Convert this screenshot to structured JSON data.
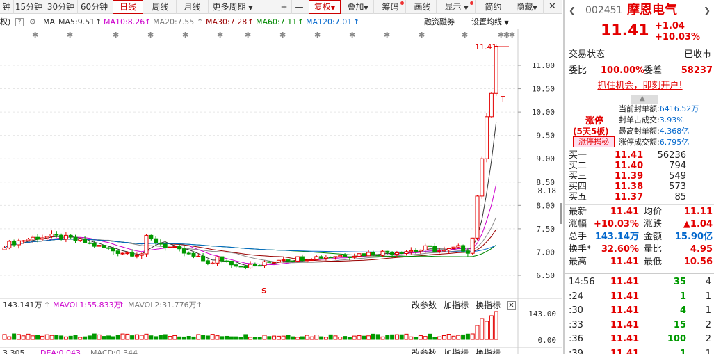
{
  "toolbar": {
    "periods": [
      "钟",
      "15分钟",
      "30分钟",
      "60分钟",
      "日线",
      "周线",
      "月线",
      "更多周期"
    ],
    "active_period": "日线",
    "plus": "+",
    "minus": "—",
    "fq_label": "复权",
    "overlay_label": "叠加",
    "chips_label": "筹码",
    "draw_label": "画线",
    "display_label": "显示",
    "simple_label": "简约",
    "hide_label": "隐藏"
  },
  "ma_bar": {
    "prefix": "权)",
    "ma_label": "MA",
    "ma5": "MA5:9.51",
    "ma10": "MA10:8.26",
    "ma20": "MA20:7.55",
    "ma30": "MA30:7.28",
    "ma60": "MA60:7.11",
    "ma120": "MA120:7.01",
    "margin_label": "融资融券",
    "settings_label": "设置均线"
  },
  "price_axis": [
    "11.00",
    "10.50",
    "10.00",
    "9.50",
    "9.00",
    "8.50",
    "8.00",
    "7.50",
    "7.00",
    "6.50"
  ],
  "crosshair_value": "8.18",
  "last_price_marker": "11.41",
  "marker_t": "T",
  "marker_s": "S",
  "volume_bar": {
    "vol": "143.141万",
    "mavol1": "MAVOL1:55.833万",
    "mavol2": "MAVOL2:31.776万",
    "edit_params": "改参数",
    "add_indicator": "加指标",
    "switch_indicator": "换指标",
    "axis_top": "143.00",
    "axis_zero": "0.00"
  },
  "macd_bar": {
    "a": "3.305",
    "b": "DEA:0.043",
    "c": "MACD:0.344",
    "edit_params": "改参数",
    "add_indicator": "加指标",
    "switch_indicator": "换指标"
  },
  "colors": {
    "up": "#e30000",
    "down": "#009900",
    "ma5": "#333333",
    "ma10": "#cc00cc",
    "ma20": "#888888",
    "ma30": "#990000",
    "ma60": "#008800",
    "ma120": "#0066cc"
  },
  "stock": {
    "code": "002451",
    "name": "摩恩电气",
    "price": "11.41",
    "change": "+1.04",
    "change_pct": "+10.03%",
    "status_label": "交易状态",
    "status_value": "已收市",
    "wb_label": "委比",
    "wb_value": "100.00%",
    "wc_label": "委差",
    "wc_value": "58237",
    "promo": "抓住机会，即刻开户!",
    "limit_title": "涨停",
    "limit_days": "(5天5板)",
    "limit_btn": "涨停揭秘",
    "seal_items": [
      {
        "label": "当前封单额:",
        "value": "6416.52万"
      },
      {
        "label": "封单占成交:",
        "value": "3.93%"
      },
      {
        "label": "最高封单额:",
        "value": "4.368亿"
      },
      {
        "label": "涨停成交额:",
        "value": "6.795亿"
      }
    ],
    "bids": [
      {
        "label": "买一",
        "price": "11.41",
        "vol": "56236"
      },
      {
        "label": "买二",
        "price": "11.40",
        "vol": "794"
      },
      {
        "label": "买三",
        "price": "11.39",
        "vol": "549"
      },
      {
        "label": "买四",
        "price": "11.38",
        "vol": "573"
      },
      {
        "label": "买五",
        "price": "11.37",
        "vol": "85"
      }
    ],
    "stats": [
      {
        "l1": "最新",
        "v1": "11.41",
        "l2": "均价",
        "v2": "11.11"
      },
      {
        "l1": "涨幅",
        "v1": "+10.03%",
        "l2": "涨跌",
        "v2": "▲1.04"
      },
      {
        "l1": "总手",
        "v1": "143.14万",
        "l2": "金额",
        "v2": "15.90亿"
      },
      {
        "l1": "换手*",
        "v1": "32.60%",
        "l2": "量比",
        "v2": "4.95"
      },
      {
        "l1": "最高",
        "v1": "11.41",
        "l2": "最低",
        "v2": "10.56"
      }
    ],
    "ticks": [
      {
        "time": "14:56",
        "price": "11.41",
        "vol": "35",
        "n": "4"
      },
      {
        "time": ":24",
        "price": "11.41",
        "vol": "1",
        "n": "1"
      },
      {
        "time": ":30",
        "price": "11.41",
        "vol": "4",
        "n": "1"
      },
      {
        "time": ":33",
        "price": "11.41",
        "vol": "15",
        "n": "2"
      },
      {
        "time": ":36",
        "price": "11.41",
        "vol": "100",
        "n": "2"
      },
      {
        "time": ":39",
        "price": "11.41",
        "vol": "1",
        "n": "1"
      }
    ]
  }
}
